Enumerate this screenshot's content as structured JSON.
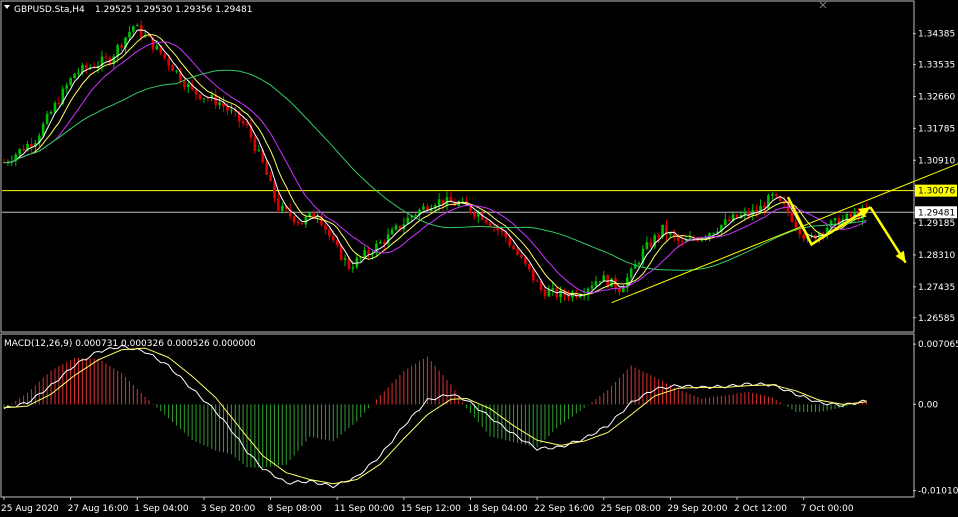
{
  "header": {
    "symbol": "GBPUSD.Sta,H4",
    "ohlc": "1.29525 1.29530 1.29356 1.29481"
  },
  "macd_header": "MACD(12,26,9) 0.000731 0.000326 0.000526 0.000000",
  "colors": {
    "background": "#000000",
    "bull": "#00c000",
    "bear": "#e00000",
    "fast_ma": "#ffffff",
    "mid_ma": "#ffff66",
    "slow_ma": "#cc33ff",
    "long_ma": "#33cc66",
    "level": "#ffff00",
    "current": "#c0c0c0",
    "arrow": "#ffff00",
    "macd_pos": "#e03030",
    "macd_neg": "#30a030",
    "macd_line": "#ffffff",
    "signal_line": "#ffff66"
  },
  "chart_data": [
    {
      "type": "candlestick",
      "title": "GBPUSD.Sta,H4",
      "ylim": [
        1.2625,
        1.352
      ],
      "price_ticks": [
        "1.34385",
        "1.33535",
        "1.32660",
        "1.31785",
        "1.30910",
        "1.30076",
        "1.29481",
        "1.29185",
        "1.28310",
        "1.27435",
        "1.26585"
      ],
      "price_tick_values": [
        1.34385,
        1.33535,
        1.3266,
        1.31785,
        1.3091,
        1.30076,
        1.29481,
        1.29185,
        1.2831,
        1.27435,
        1.26585
      ],
      "level_price": 1.30076,
      "level_label": "1.30076",
      "current_price": 1.29481,
      "current_label": "1.29481",
      "x_labels": [
        "25 Aug 2020",
        "27 Aug 16:00",
        "1 Sep 04:00",
        "3 Sep 20:00",
        "8 Sep 08:00",
        "11 Sep 00:00",
        "15 Sep 12:00",
        "18 Sep 04:00",
        "22 Sep 16:00",
        "25 Sep 08:00",
        "29 Sep 20:00",
        "2 Oct 12:00",
        "7 Oct 00:00"
      ],
      "x_label_bars": [
        0,
        17,
        34,
        51,
        68,
        85,
        102,
        119,
        136,
        153,
        170,
        187,
        204
      ],
      "price_path": [
        [
          0,
          1.3085
        ],
        [
          8,
          1.315
        ],
        [
          18,
          1.333
        ],
        [
          27,
          1.337
        ],
        [
          33,
          1.346
        ],
        [
          37,
          1.342
        ],
        [
          42,
          1.336
        ],
        [
          48,
          1.328
        ],
        [
          55,
          1.325
        ],
        [
          62,
          1.318
        ],
        [
          66,
          1.308
        ],
        [
          70,
          1.296
        ],
        [
          76,
          1.292
        ],
        [
          80,
          1.295
        ],
        [
          84,
          1.286
        ],
        [
          88,
          1.28
        ],
        [
          92,
          1.283
        ],
        [
          98,
          1.288
        ],
        [
          104,
          1.294
        ],
        [
          110,
          1.298
        ],
        [
          116,
          1.297
        ],
        [
          122,
          1.294
        ],
        [
          128,
          1.288
        ],
        [
          133,
          1.28
        ],
        [
          137,
          1.2735
        ],
        [
          142,
          1.272
        ],
        [
          147,
          1.273
        ],
        [
          152,
          1.277
        ],
        [
          157,
          1.274
        ],
        [
          160,
          1.278
        ],
        [
          163,
          1.284
        ],
        [
          168,
          1.29
        ],
        [
          173,
          1.286
        ],
        [
          179,
          1.289
        ],
        [
          186,
          1.293
        ],
        [
          192,
          1.295
        ],
        [
          196,
          1.299
        ],
        [
          200,
          1.295
        ],
        [
          205,
          1.287
        ],
        [
          210,
          1.291
        ],
        [
          216,
          1.2935
        ],
        [
          220,
          1.2948
        ]
      ],
      "trendline": [
        [
          155,
          1.27
        ],
        [
          250,
          1.311
        ]
      ],
      "forecast_arrows": [
        [
          [
            200,
            1.299
          ],
          [
            206,
            1.286
          ],
          [
            221,
            1.2962
          ]
        ],
        [
          [
            221,
            1.2962
          ],
          [
            230,
            1.281
          ]
        ]
      ]
    },
    {
      "type": "histogram",
      "title": "MACD(12,26,9) 0.000731 0.000326 0.000526 0.000000",
      "ylim": [
        -0.0105,
        0.00755
      ],
      "ticks": [
        "0.007065",
        "0.00",
        "-0.010105"
      ],
      "tick_values": [
        0.007065,
        0.0,
        -0.010105
      ],
      "macd_path": [
        [
          0,
          -0.0005
        ],
        [
          6,
          0.0002
        ],
        [
          12,
          0.0022
        ],
        [
          18,
          0.0046
        ],
        [
          24,
          0.0062
        ],
        [
          30,
          0.0068
        ],
        [
          36,
          0.0062
        ],
        [
          42,
          0.0045
        ],
        [
          48,
          0.0018
        ],
        [
          54,
          -0.0008
        ],
        [
          58,
          -0.003
        ],
        [
          62,
          -0.0055
        ],
        [
          66,
          -0.0075
        ],
        [
          72,
          -0.0092
        ],
        [
          78,
          -0.009
        ],
        [
          84,
          -0.0096
        ],
        [
          90,
          -0.0085
        ],
        [
          96,
          -0.006
        ],
        [
          102,
          -0.0025
        ],
        [
          108,
          0.0005
        ],
        [
          114,
          0.0012
        ],
        [
          118,
          0.0005
        ],
        [
          124,
          -0.0015
        ],
        [
          130,
          -0.0035
        ],
        [
          136,
          -0.0052
        ],
        [
          142,
          -0.005
        ],
        [
          148,
          -0.004
        ],
        [
          154,
          -0.0025
        ],
        [
          160,
          0.0002
        ],
        [
          166,
          0.0018
        ],
        [
          172,
          0.0022
        ],
        [
          178,
          0.002
        ],
        [
          184,
          0.0021
        ],
        [
          190,
          0.0024
        ],
        [
          196,
          0.0023
        ],
        [
          202,
          0.0012
        ],
        [
          208,
          0.0002
        ],
        [
          214,
          -0.0001
        ],
        [
          220,
          0.0004
        ]
      ],
      "signal_path": [
        [
          0,
          -0.0004
        ],
        [
          6,
          -0.0002
        ],
        [
          12,
          0.0012
        ],
        [
          18,
          0.0034
        ],
        [
          24,
          0.0052
        ],
        [
          30,
          0.0064
        ],
        [
          36,
          0.0066
        ],
        [
          42,
          0.0055
        ],
        [
          48,
          0.0033
        ],
        [
          54,
          0.0008
        ],
        [
          58,
          -0.0015
        ],
        [
          62,
          -0.0038
        ],
        [
          66,
          -0.006
        ],
        [
          72,
          -0.008
        ],
        [
          78,
          -0.0088
        ],
        [
          84,
          -0.0093
        ],
        [
          90,
          -0.0088
        ],
        [
          96,
          -0.007
        ],
        [
          102,
          -0.004
        ],
        [
          108,
          -0.0012
        ],
        [
          114,
          0.0006
        ],
        [
          118,
          0.0007
        ],
        [
          124,
          -0.0005
        ],
        [
          130,
          -0.0025
        ],
        [
          136,
          -0.0042
        ],
        [
          142,
          -0.0048
        ],
        [
          148,
          -0.0043
        ],
        [
          154,
          -0.0033
        ],
        [
          160,
          -0.0012
        ],
        [
          166,
          0.001
        ],
        [
          172,
          0.0019
        ],
        [
          178,
          0.002
        ],
        [
          184,
          0.002
        ],
        [
          190,
          0.0022
        ],
        [
          196,
          0.0023
        ],
        [
          202,
          0.0016
        ],
        [
          208,
          0.0005
        ],
        [
          214,
          0.0
        ],
        [
          220,
          0.0003
        ]
      ]
    }
  ]
}
